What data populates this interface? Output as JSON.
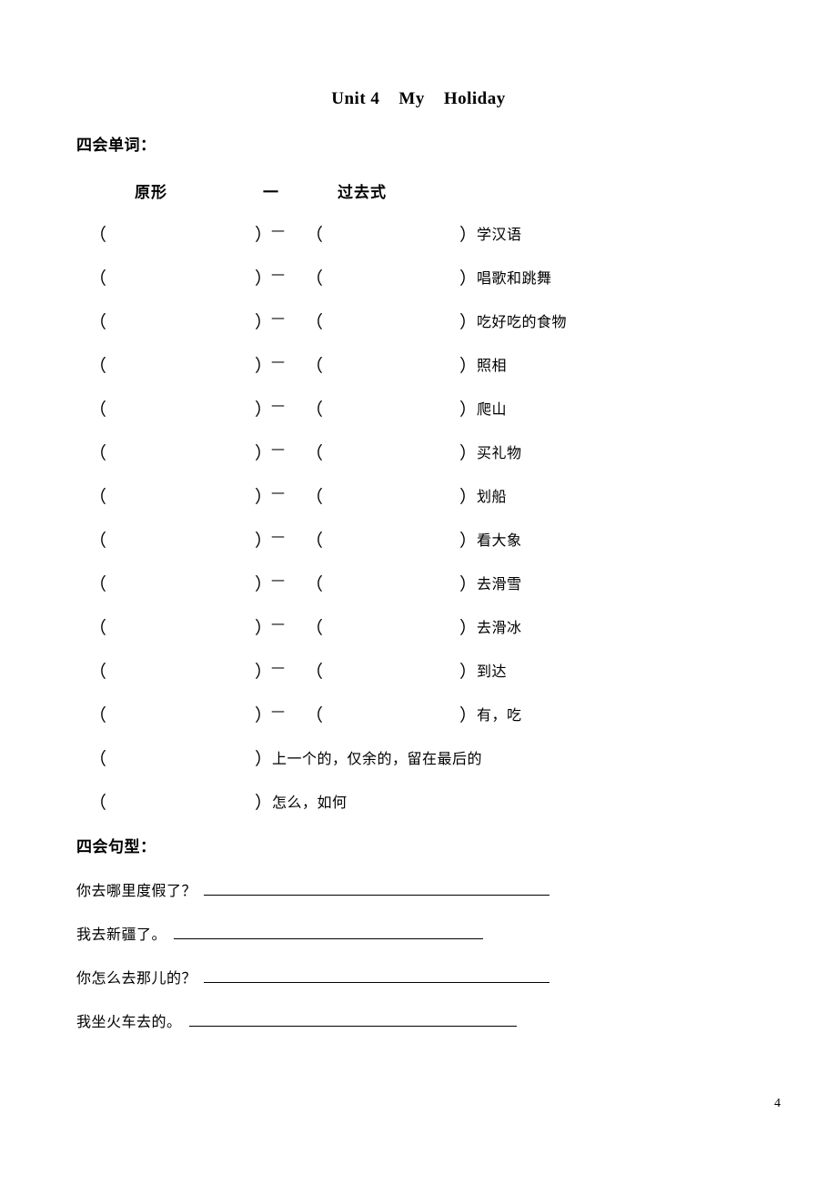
{
  "document": {
    "title": "Unit 4    My    Holiday",
    "page_number": "4"
  },
  "words_section": {
    "heading": "四会单词：",
    "column_headers": {
      "base_form": "原形",
      "separator": "一",
      "past_form": "过去式"
    },
    "paren_open": "（",
    "paren_close": "）",
    "dash": "—",
    "rows": [
      {
        "meaning": "学汉语",
        "has_past": true
      },
      {
        "meaning": "唱歌和跳舞",
        "has_past": true
      },
      {
        "meaning": "吃好吃的食物",
        "has_past": true
      },
      {
        "meaning": "照相",
        "has_past": true
      },
      {
        "meaning": "爬山",
        "has_past": true
      },
      {
        "meaning": "买礼物",
        "has_past": true
      },
      {
        "meaning": "划船",
        "has_past": true
      },
      {
        "meaning": "看大象",
        "has_past": true
      },
      {
        "meaning": "去滑雪",
        "has_past": true
      },
      {
        "meaning": "去滑冰",
        "has_past": true
      },
      {
        "meaning": "到达",
        "has_past": true
      },
      {
        "meaning": "有，吃",
        "has_past": true
      },
      {
        "meaning": "上一个的，仅余的，留在最后的",
        "has_past": false
      },
      {
        "meaning": "怎么，如何",
        "has_past": false
      }
    ]
  },
  "sentences_section": {
    "heading": "四会句型：",
    "rows": [
      {
        "prompt": "你去哪里度假了？",
        "blank_width": 380
      },
      {
        "prompt": "我去新疆了。",
        "blank_width": 340
      },
      {
        "prompt": "你怎么去那儿的？",
        "blank_width": 380
      },
      {
        "prompt": "我坐火车去的。",
        "blank_width": 360
      }
    ]
  }
}
